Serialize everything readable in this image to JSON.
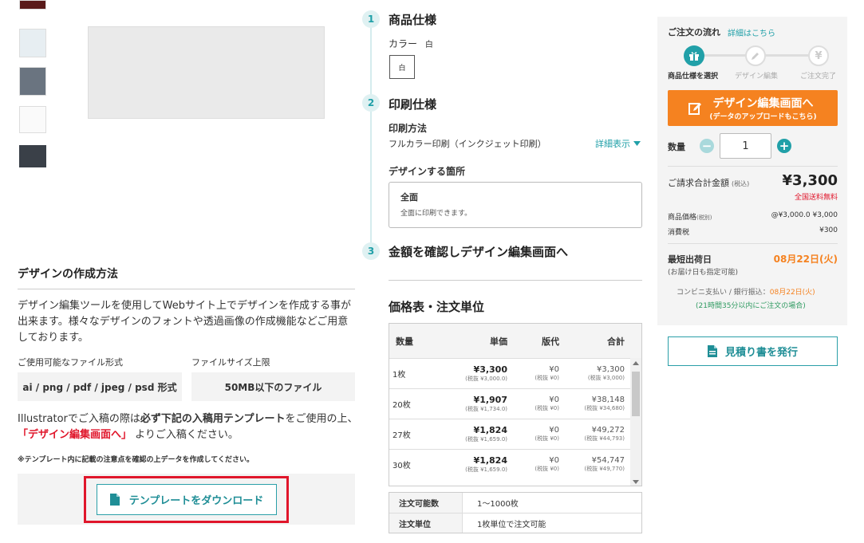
{
  "gallery": {
    "thumb_count": 5
  },
  "design_method": {
    "title": "デザインの作成方法",
    "description": "デザイン編集ツールを使用してWebサイト上でデザインを作成する事が出来ます。様々なデザインのフォントや透過画像の作成機能などご用意しております。",
    "file_format_label": "ご使用可能なファイル形式",
    "file_format_value": "ai / png / pdf / jpeg / psd 形式",
    "file_size_label": "ファイルサイズ上限",
    "file_size_value": "50MB以下のファイル",
    "illus_pre": "Illustratorでご入稿の際は",
    "illus_bold": "必ず下記の入稿用テンプレート",
    "illus_mid": "をご使用の上、",
    "illus_link": "「デザイン編集画面へ」",
    "illus_post": "よりご入稿ください。",
    "note": "※テンプレート内に記載の注意点を確認の上データを作成してください。",
    "download_label": "テンプレートをダウンロード"
  },
  "steps": [
    {
      "num": "1",
      "title": "商品仕様"
    },
    {
      "num": "2",
      "title": "印刷仕様"
    },
    {
      "num": "3",
      "title": "金額を確認しデザイン編集画面へ"
    }
  ],
  "spec": {
    "color_label": "カラー",
    "color_value": "白",
    "color_option": "白"
  },
  "print": {
    "method_label": "印刷方法",
    "method_value": "フルカラー印刷（インクジェット印刷）",
    "detail_link": "詳細表示",
    "area_label": "デザインする箇所",
    "area_title": "全面",
    "area_desc": "全面に印刷できます。"
  },
  "price_table": {
    "title": "価格表・注文単位",
    "headers": [
      "数量",
      "単価",
      "版代",
      "合計"
    ],
    "rows": [
      {
        "qty": "1枚",
        "unit": "¥3,300",
        "unit_ex": "(税抜 ¥3,000.0)",
        "plate": "¥0",
        "plate_ex": "(税抜 ¥0)",
        "total": "¥3,300",
        "total_ex": "(税抜 ¥3,000)"
      },
      {
        "qty": "20枚",
        "unit": "¥1,907",
        "unit_ex": "(税抜 ¥1,734.0)",
        "plate": "¥0",
        "plate_ex": "(税抜 ¥0)",
        "total": "¥38,148",
        "total_ex": "(税抜 ¥34,680)"
      },
      {
        "qty": "27枚",
        "unit": "¥1,824",
        "unit_ex": "(税抜 ¥1,659.0)",
        "plate": "¥0",
        "plate_ex": "(税抜 ¥0)",
        "total": "¥49,272",
        "total_ex": "(税抜 ¥44,793)"
      },
      {
        "qty": "30枚",
        "unit": "¥1,824",
        "unit_ex": "(税抜 ¥1,659.0)",
        "plate": "¥0",
        "plate_ex": "(税抜 ¥0)",
        "total": "¥54,747",
        "total_ex": "(税抜 ¥49,770)"
      }
    ],
    "order_range_label": "注文可能数",
    "order_range_value": "1〜1000枚",
    "order_unit_label": "注文単位",
    "order_unit_value": "1枚単位で注文可能"
  },
  "order_panel": {
    "flow_title": "ご注文の流れ",
    "flow_link": "詳細はこちら",
    "flow_steps": [
      "商品仕様を選択",
      "デザイン編集",
      "ご注文完了"
    ],
    "edit_button_main": "デザイン編集画面へ",
    "edit_button_sub": "(データのアップロードもこちら)",
    "qty_label": "数量",
    "qty_value": "1",
    "total_label": "ご請求合計金額",
    "total_tax_note": "(税込)",
    "total_value": "¥3,300",
    "free_shipping": "全国送料無料",
    "item_price_label": "商品価格",
    "item_price_note": "(税別)",
    "item_price_value": "@¥3,000.0 ¥3,000",
    "tax_label": "消費税",
    "tax_value": "¥300",
    "ship_label": "最短出荷日",
    "ship_sub": "(お届け日も指定可能)",
    "ship_date": "08月22日(火)",
    "conv_pay_prefix": "コンビニ支払い / 銀行振込：",
    "conv_pay_date": "08月22日(火)",
    "deadline_note": "(21時間35分以内にご注文の場合)",
    "estimate_button": "見積り書を発行"
  },
  "colors": {
    "teal": "#21a0a8",
    "orange": "#f58220",
    "red": "#e0162b",
    "green": "#2e9a60"
  }
}
